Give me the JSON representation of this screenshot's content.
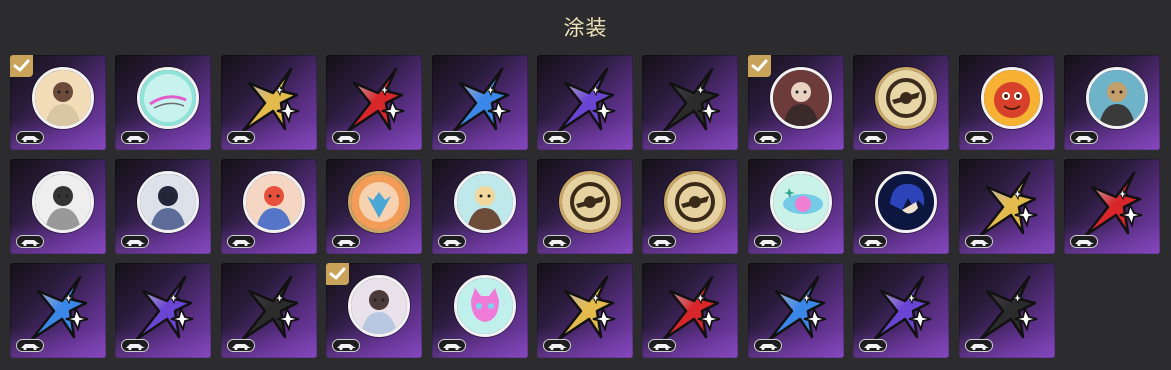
{
  "header": {
    "title": "涂装"
  },
  "colors": {
    "check_badge": "#caa35a",
    "tile_purple": "#7b43b3",
    "title_text": "#efe2b8"
  },
  "skins": [
    {
      "kind": "portrait",
      "icon": "portrait-woman-icon",
      "selected": true,
      "palette": [
        "#f3dcb8",
        "#6b4a3a",
        "#d9c7a4"
      ]
    },
    {
      "kind": "abstract",
      "icon": "teal-orb-icon",
      "selected": false,
      "palette": [
        "#8fe3d8",
        "#c7f2ee",
        "#e35ccc"
      ]
    },
    {
      "kind": "star",
      "icon": "gold-star-icon",
      "selected": false,
      "color": "#e2bb4c"
    },
    {
      "kind": "star",
      "icon": "red-star-icon",
      "selected": false,
      "color": "#d8262a"
    },
    {
      "kind": "star",
      "icon": "blue-star-icon",
      "selected": false,
      "color": "#3b87e8"
    },
    {
      "kind": "star",
      "icon": "purple-star-icon",
      "selected": false,
      "color": "#6a45d4"
    },
    {
      "kind": "star",
      "icon": "black-star-icon",
      "selected": false,
      "color": "#2b2b2b"
    },
    {
      "kind": "portrait",
      "icon": "portrait-group-icon",
      "selected": true,
      "palette": [
        "#6e3b3b",
        "#e8d2c2",
        "#3a2a2a"
      ]
    },
    {
      "kind": "emblem",
      "icon": "gold-ring-emblem-icon",
      "selected": false,
      "palette": [
        "#e9d6a6",
        "#3b2b1c"
      ]
    },
    {
      "kind": "portrait",
      "icon": "red-creature-icon",
      "selected": false,
      "palette": [
        "#d7402a",
        "#f7b233",
        "#4a1c0c"
      ]
    },
    {
      "kind": "portrait",
      "icon": "portrait-desert-icon",
      "selected": false,
      "palette": [
        "#6fb3c8",
        "#c3a06b",
        "#3a3a3a"
      ]
    },
    {
      "kind": "portrait",
      "icon": "masked-chibi-icon",
      "selected": false,
      "palette": [
        "#eeeeee",
        "#333333",
        "#999999"
      ]
    },
    {
      "kind": "portrait",
      "icon": "chibi-suit-icon",
      "selected": false,
      "palette": [
        "#dde2ea",
        "#23273a",
        "#5d6c98"
      ]
    },
    {
      "kind": "portrait",
      "icon": "chibi-group-icon",
      "selected": false,
      "palette": [
        "#f4d6c2",
        "#e7503c",
        "#5576c8"
      ]
    },
    {
      "kind": "emblem",
      "icon": "orange-crest-icon",
      "selected": false,
      "palette": [
        "#f29c57",
        "#f7d2b0",
        "#4aa7d6"
      ]
    },
    {
      "kind": "portrait",
      "icon": "blonde-chibi-icon",
      "selected": false,
      "palette": [
        "#bfe8ea",
        "#f2d79c",
        "#6d4c3a"
      ]
    },
    {
      "kind": "emblem",
      "icon": "gold-fist-emblem-icon",
      "selected": false,
      "palette": [
        "#e6d2a1",
        "#3a2a18"
      ]
    },
    {
      "kind": "emblem",
      "icon": "gold-wings-emblem-icon",
      "selected": false,
      "palette": [
        "#e6d2a1",
        "#3a2a18"
      ]
    },
    {
      "kind": "abstract",
      "icon": "pastel-planet-icon",
      "selected": false,
      "palette": [
        "#c9f2e8",
        "#ef7fd3",
        "#74cbe8"
      ]
    },
    {
      "kind": "portrait",
      "icon": "blue-hair-icon",
      "selected": false,
      "palette": [
        "#2c44b8",
        "#f0e0d0",
        "#0d163e"
      ]
    },
    {
      "kind": "star",
      "icon": "gold-star-icon",
      "selected": false,
      "color": "#e2bb4c"
    },
    {
      "kind": "star",
      "icon": "red-star-icon",
      "selected": false,
      "color": "#d8262a"
    },
    {
      "kind": "star",
      "icon": "blue-star-icon",
      "selected": false,
      "color": "#3b87e8"
    },
    {
      "kind": "star",
      "icon": "purple-star-icon",
      "selected": false,
      "color": "#6a45d4"
    },
    {
      "kind": "star",
      "icon": "black-star-icon",
      "selected": false,
      "color": "#2b2b2b"
    },
    {
      "kind": "portrait",
      "icon": "portrait-duo-icon",
      "selected": true,
      "palette": [
        "#e9e2ea",
        "#4a3a3a",
        "#b8c8e0"
      ]
    },
    {
      "kind": "abstract",
      "icon": "pink-cat-icon",
      "selected": false,
      "palette": [
        "#bff0ec",
        "#f07ad8",
        "#7ad6f0"
      ]
    },
    {
      "kind": "star",
      "icon": "gold-star-icon",
      "selected": false,
      "color": "#e2bb4c"
    },
    {
      "kind": "star",
      "icon": "red-star-icon",
      "selected": false,
      "color": "#d8262a"
    },
    {
      "kind": "star",
      "icon": "blue-star-icon",
      "selected": false,
      "color": "#3b87e8"
    },
    {
      "kind": "star",
      "icon": "purple-star-icon",
      "selected": false,
      "color": "#6a45d4"
    },
    {
      "kind": "star",
      "icon": "black-star-icon",
      "selected": false,
      "color": "#2b2b2b"
    }
  ]
}
